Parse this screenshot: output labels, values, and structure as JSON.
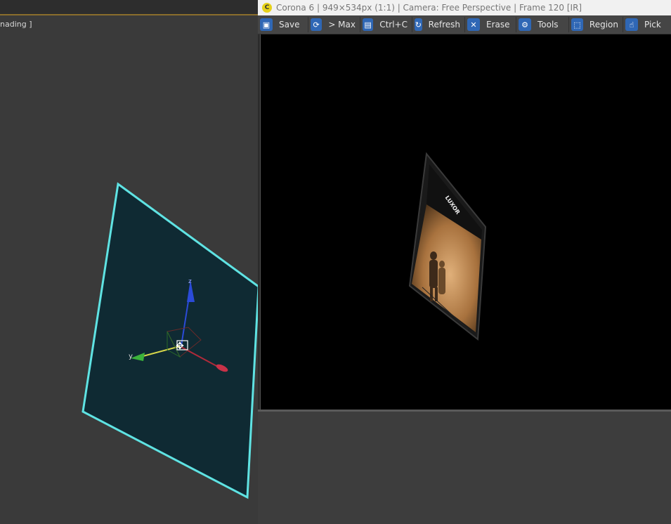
{
  "viewport": {
    "label": "nading ]",
    "gizmo_y_label": "y",
    "gizmo_z_label": "z"
  },
  "vfb": {
    "logo_glyph": "C",
    "title": "Corona 6 | 949×534px (1:1) | Camera: Free Perspective | Frame 120 [IR]",
    "toolbar": [
      {
        "icon": "save-icon",
        "glyph": "▣",
        "label": "Save"
      },
      {
        "icon": "max-icon",
        "glyph": "⟳",
        "label": "> Max"
      },
      {
        "icon": "copy-icon",
        "glyph": "▤",
        "label": "Ctrl+C"
      },
      {
        "icon": "refresh-icon",
        "glyph": "↻",
        "label": "Refresh"
      },
      {
        "icon": "erase-icon",
        "glyph": "✕",
        "label": "Erase"
      },
      {
        "icon": "tools-icon",
        "glyph": "⚙",
        "label": "Tools"
      },
      {
        "icon": "region-icon",
        "glyph": "⬚",
        "label": "Region"
      },
      {
        "icon": "pick-icon",
        "glyph": "☝",
        "label": "Pick"
      }
    ],
    "render_sign_text": "LUXOR"
  },
  "colors": {
    "selection_outline": "#5fe3e3",
    "plane_fill": "#0f2a33",
    "toolbar_icon": "#2f67b5",
    "logo": "#e6d21a"
  }
}
